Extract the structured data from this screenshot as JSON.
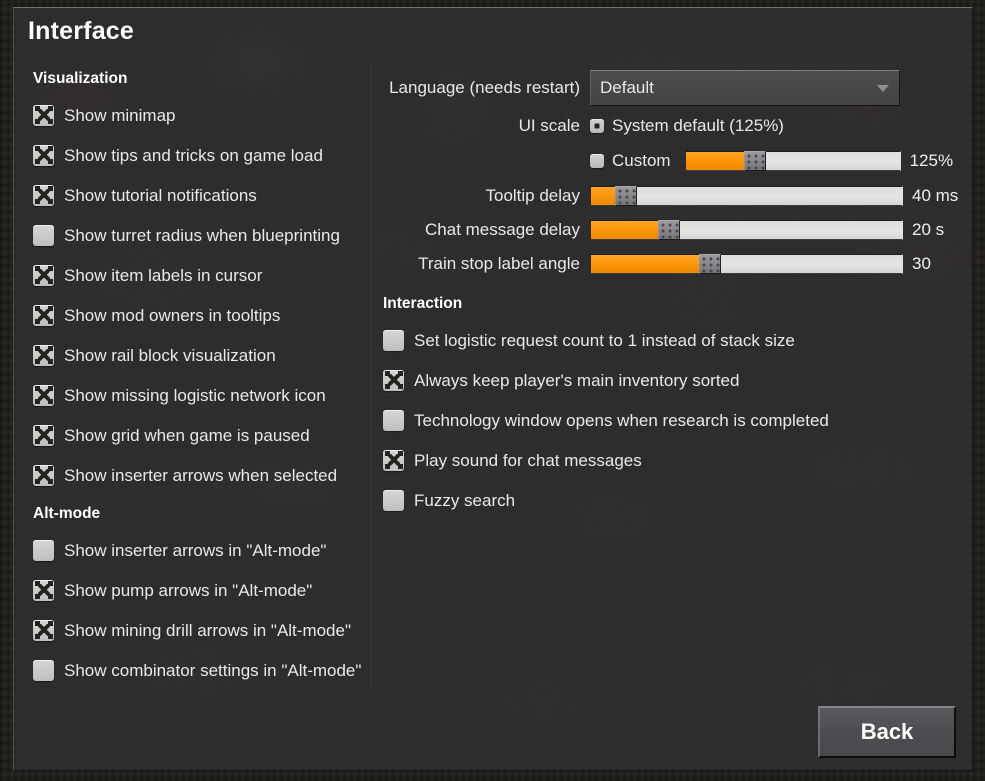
{
  "window": {
    "title": "Interface"
  },
  "left": {
    "sections": [
      {
        "heading": "Visualization",
        "items": [
          {
            "label": "Show minimap",
            "checked": true
          },
          {
            "label": "Show tips and tricks on game load",
            "checked": true
          },
          {
            "label": "Show tutorial notifications",
            "checked": true
          },
          {
            "label": "Show turret radius when blueprinting",
            "checked": false
          },
          {
            "label": "Show item labels in cursor",
            "checked": true
          },
          {
            "label": "Show mod owners in tooltips",
            "checked": true
          },
          {
            "label": "Show rail block visualization",
            "checked": true
          },
          {
            "label": "Show missing logistic network icon",
            "checked": true
          },
          {
            "label": "Show grid when game is paused",
            "checked": true
          },
          {
            "label": "Show inserter arrows when selected",
            "checked": true
          }
        ]
      },
      {
        "heading": "Alt-mode",
        "items": [
          {
            "label": "Show inserter arrows in \"Alt-mode\"",
            "checked": false
          },
          {
            "label": "Show pump arrows in \"Alt-mode\"",
            "checked": true
          },
          {
            "label": "Show mining drill arrows in \"Alt-mode\"",
            "checked": true
          },
          {
            "label": "Show combinator settings in \"Alt-mode\"",
            "checked": false
          }
        ]
      }
    ]
  },
  "right": {
    "language": {
      "label": "Language (needs restart)",
      "value": "Default",
      "caret": "chevron-down-icon"
    },
    "ui_scale": {
      "label": "UI scale",
      "system_default": {
        "label": "System default (125%)",
        "selected": true
      },
      "custom": {
        "label": "Custom",
        "selected": false,
        "value": "125%",
        "fill_percent": 28
      }
    },
    "sliders": [
      {
        "label": "Tooltip delay",
        "value": "40 ms",
        "fill_percent": 8
      },
      {
        "label": "Chat message delay",
        "value": "20 s",
        "fill_percent": 22
      },
      {
        "label": "Train stop label angle",
        "value": "30",
        "fill_percent": 35
      }
    ],
    "interaction": {
      "heading": "Interaction",
      "items": [
        {
          "label": "Set logistic request count to 1 instead of stack size",
          "checked": false
        },
        {
          "label": "Always keep player's main inventory sorted",
          "checked": true
        },
        {
          "label": "Technology window opens when research is completed",
          "checked": false
        },
        {
          "label": "Play sound for chat messages",
          "checked": true
        },
        {
          "label": "Fuzzy search",
          "checked": false
        }
      ]
    }
  },
  "footer": {
    "back_label": "Back"
  },
  "colors": {
    "accent_orange": "#fb9406",
    "panel_bg": "#303032",
    "text": "#e9e9e9",
    "checkbox_face": "#cfcfcf"
  }
}
